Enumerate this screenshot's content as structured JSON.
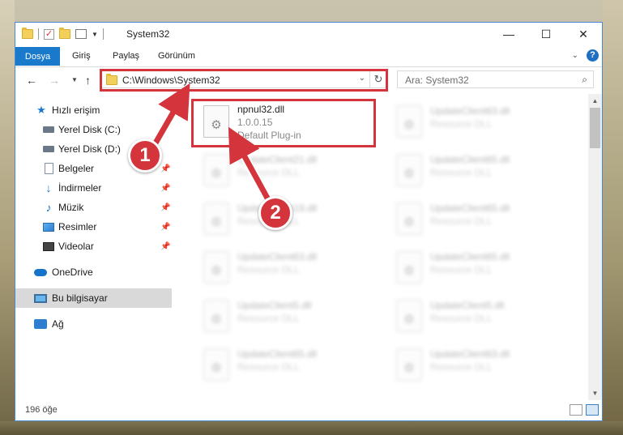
{
  "window": {
    "title": "System32",
    "controls": {
      "minimize": "—",
      "maximize": "☐",
      "close": "✕"
    }
  },
  "ribbon": {
    "file_tab": "Dosya",
    "tabs": [
      "Giriş",
      "Paylaş",
      "Görünüm"
    ],
    "help": "?"
  },
  "navigation": {
    "back": "←",
    "forward": "→",
    "up": "↑",
    "address": "C:\\Windows\\System32",
    "refresh": "↻",
    "search_placeholder": "Ara: System32"
  },
  "sidebar": {
    "items": [
      {
        "label": "Hızlı erişim",
        "icon": "star-icon",
        "pinned": false
      },
      {
        "label": "Yerel Disk (C:)",
        "icon": "drive-icon",
        "pinned": false
      },
      {
        "label": "Yerel Disk (D:)",
        "icon": "drive-icon",
        "pinned": false
      },
      {
        "label": "Belgeler",
        "icon": "documents-icon",
        "pinned": true
      },
      {
        "label": "İndirmeler",
        "icon": "downloads-icon",
        "pinned": true
      },
      {
        "label": "Müzik",
        "icon": "music-icon",
        "pinned": true
      },
      {
        "label": "Resimler",
        "icon": "pictures-icon",
        "pinned": true
      },
      {
        "label": "Videolar",
        "icon": "videos-icon",
        "pinned": true
      },
      {
        "label": "OneDrive",
        "icon": "onedrive-icon",
        "pinned": false
      },
      {
        "label": "Bu bilgisayar",
        "icon": "this-pc-icon",
        "pinned": false,
        "selected": true
      },
      {
        "label": "Ağ",
        "icon": "network-icon",
        "pinned": false
      }
    ]
  },
  "files": {
    "featured": {
      "name": "npnul32.dll",
      "version": "1.0.0.15",
      "description": "Default Plug-in"
    },
    "left_column": [
      {
        "name": "UpdateClient21.dll",
        "type": "Resource DLL"
      },
      {
        "name": "UpdateClient19.dll",
        "type": "Resource DLL"
      },
      {
        "name": "UpdateClient63.dll",
        "type": "Resource DLL"
      },
      {
        "name": "UpdateClient5.dll",
        "type": "Resource DLL"
      },
      {
        "name": "UpdateClient65.dll",
        "type": "Resource DLL"
      }
    ],
    "right_column": [
      {
        "name": "UpdateClient63.dll",
        "type": "Resource DLL"
      },
      {
        "name": "UpdateClient65.dll",
        "type": "Resource DLL"
      },
      {
        "name": "UpdateClient65.dll",
        "type": "Resource DLL"
      },
      {
        "name": "UpdateClient65.dll",
        "type": "Resource DLL"
      },
      {
        "name": "UpdateClient5.dll",
        "type": "Resource DLL"
      },
      {
        "name": "UpdateClient63.dll",
        "type": "Resource DLL"
      }
    ]
  },
  "status": {
    "item_count": "196 öğe"
  },
  "annotations": {
    "marker_1": "1",
    "marker_2": "2",
    "color": "#d4343b"
  }
}
